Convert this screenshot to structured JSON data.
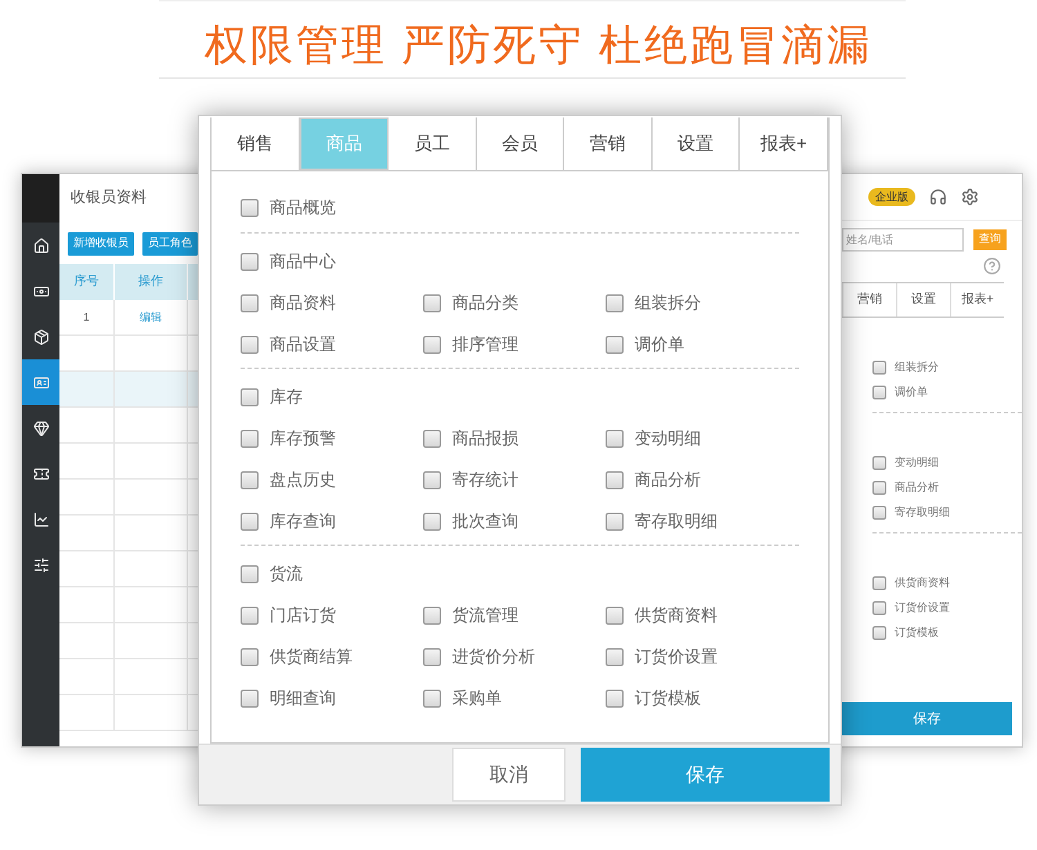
{
  "headline": "权限管理 严防死守 杜绝跑冒滴漏",
  "back_window": {
    "sidebar": {
      "items": [
        {
          "selected": false
        },
        {
          "selected": false
        },
        {
          "selected": false
        },
        {
          "selected": true
        },
        {
          "selected": false
        },
        {
          "selected": false
        },
        {
          "selected": false
        },
        {
          "selected": false
        }
      ]
    },
    "title": "收银员资料",
    "buttons": [
      "新增收银员",
      "员工角色"
    ],
    "table": {
      "columns": [
        "序号",
        "操作"
      ],
      "rows": [
        [
          "1",
          "编辑"
        ]
      ]
    }
  },
  "right_panel": {
    "badge": "企业版",
    "search": {
      "placeholder": "姓名/电话"
    },
    "query_button": "查询",
    "tabs": [
      {
        "label": "营销",
        "selected": false
      },
      {
        "label": "设置",
        "selected": false
      },
      {
        "label": "报表+",
        "selected": false
      }
    ],
    "groups": [
      [
        {
          "label": "组装拆分",
          "checked": false
        },
        {
          "label": "调价单",
          "checked": false
        }
      ],
      [
        {
          "label": "变动明细",
          "checked": false
        },
        {
          "label": "商品分析",
          "checked": false
        },
        {
          "label": "寄存取明细",
          "checked": false
        }
      ],
      [
        {
          "label": "供货商资料",
          "checked": false
        },
        {
          "label": "订货价设置",
          "checked": false
        },
        {
          "label": "订货模板",
          "checked": false
        }
      ]
    ],
    "save_button": "保存"
  },
  "dialog": {
    "tabs": [
      {
        "label": "销售",
        "selected": false
      },
      {
        "label": "商品",
        "selected": true
      },
      {
        "label": "员工",
        "selected": false
      },
      {
        "label": "会员",
        "selected": false
      },
      {
        "label": "营销",
        "selected": false
      },
      {
        "label": "设置",
        "selected": false
      },
      {
        "label": "报表+",
        "selected": false
      }
    ],
    "sections": [
      {
        "label": "商品概览",
        "checked": false
      },
      {
        "label": "商品中心",
        "checked": false,
        "items": [
          {
            "label": "商品资料",
            "checked": false
          },
          {
            "label": "商品分类",
            "checked": false
          },
          {
            "label": "组装拆分",
            "checked": false
          },
          {
            "label": "商品设置",
            "checked": false
          },
          {
            "label": "排序管理",
            "checked": false
          },
          {
            "label": "调价单",
            "checked": false
          }
        ]
      },
      {
        "label": "库存",
        "checked": false,
        "items": [
          {
            "label": "库存预警",
            "checked": false
          },
          {
            "label": "商品报损",
            "checked": false
          },
          {
            "label": "变动明细",
            "checked": false
          },
          {
            "label": "盘点历史",
            "checked": false
          },
          {
            "label": "寄存统计",
            "checked": false
          },
          {
            "label": "商品分析",
            "checked": false
          },
          {
            "label": "库存查询",
            "checked": false
          },
          {
            "label": "批次查询",
            "checked": false
          },
          {
            "label": "寄存取明细",
            "checked": false
          }
        ]
      },
      {
        "label": "货流",
        "checked": false,
        "items": [
          {
            "label": "门店订货",
            "checked": false
          },
          {
            "label": "货流管理",
            "checked": false
          },
          {
            "label": "供货商资料",
            "checked": false
          },
          {
            "label": "供货商结算",
            "checked": false
          },
          {
            "label": "进货价分析",
            "checked": false
          },
          {
            "label": "订货价设置",
            "checked": false
          },
          {
            "label": "明细查询",
            "checked": false
          },
          {
            "label": "采购单",
            "checked": false
          },
          {
            "label": "订货模板",
            "checked": false
          }
        ]
      }
    ],
    "cancel_button": "取消",
    "save_button": "保存"
  }
}
